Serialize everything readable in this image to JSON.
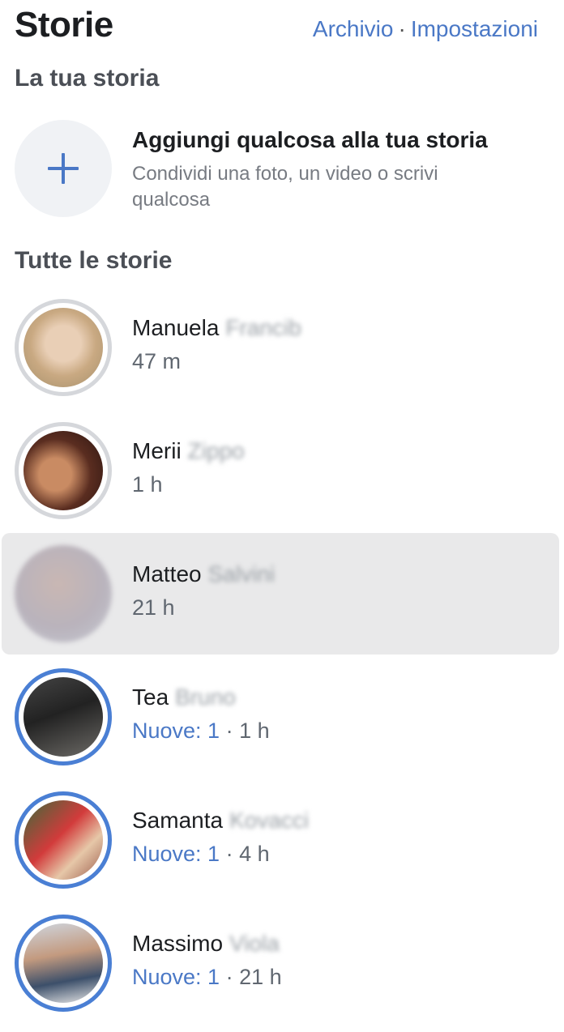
{
  "header": {
    "title": "Storie",
    "archive_label": "Archivio",
    "separator": "·",
    "settings_label": "Impostazioni"
  },
  "your_story": {
    "section_title": "La tua storia",
    "add_title": "Aggiungi qualcosa alla tua storia",
    "add_subtitle": "Condividi una foto, un video o scrivi qualcosa",
    "add_icon": "plus-icon"
  },
  "all_stories": {
    "section_title": "Tutte le storie",
    "items": [
      {
        "first_name": "Manuela",
        "last_name": "Francib",
        "time": "47 m",
        "new_label": "",
        "separator": "",
        "seen": true
      },
      {
        "first_name": "Merii",
        "last_name": "Zippo",
        "time": "1 h",
        "new_label": "",
        "separator": "",
        "seen": true
      },
      {
        "first_name": "Matteo",
        "last_name": "Salvini",
        "time": "21 h",
        "new_label": "",
        "separator": "",
        "seen": true,
        "selected": true
      },
      {
        "first_name": "Tea",
        "last_name": "Bruno",
        "time": "1 h",
        "new_label": "Nuove: 1",
        "separator": " · ",
        "seen": false
      },
      {
        "first_name": "Samanta",
        "last_name": "Kovacci",
        "time": "4 h",
        "new_label": "Nuove: 1",
        "separator": " · ",
        "seen": false
      },
      {
        "first_name": "Massimo",
        "last_name": "Viola",
        "time": "21 h",
        "new_label": "Nuove: 1",
        "separator": " · ",
        "seen": false
      }
    ]
  },
  "colors": {
    "accent": "#4a78c6",
    "unseen_ring": "#4a7fd4",
    "seen_ring": "#d5d7db",
    "selected_row": "#e9e9ea"
  }
}
